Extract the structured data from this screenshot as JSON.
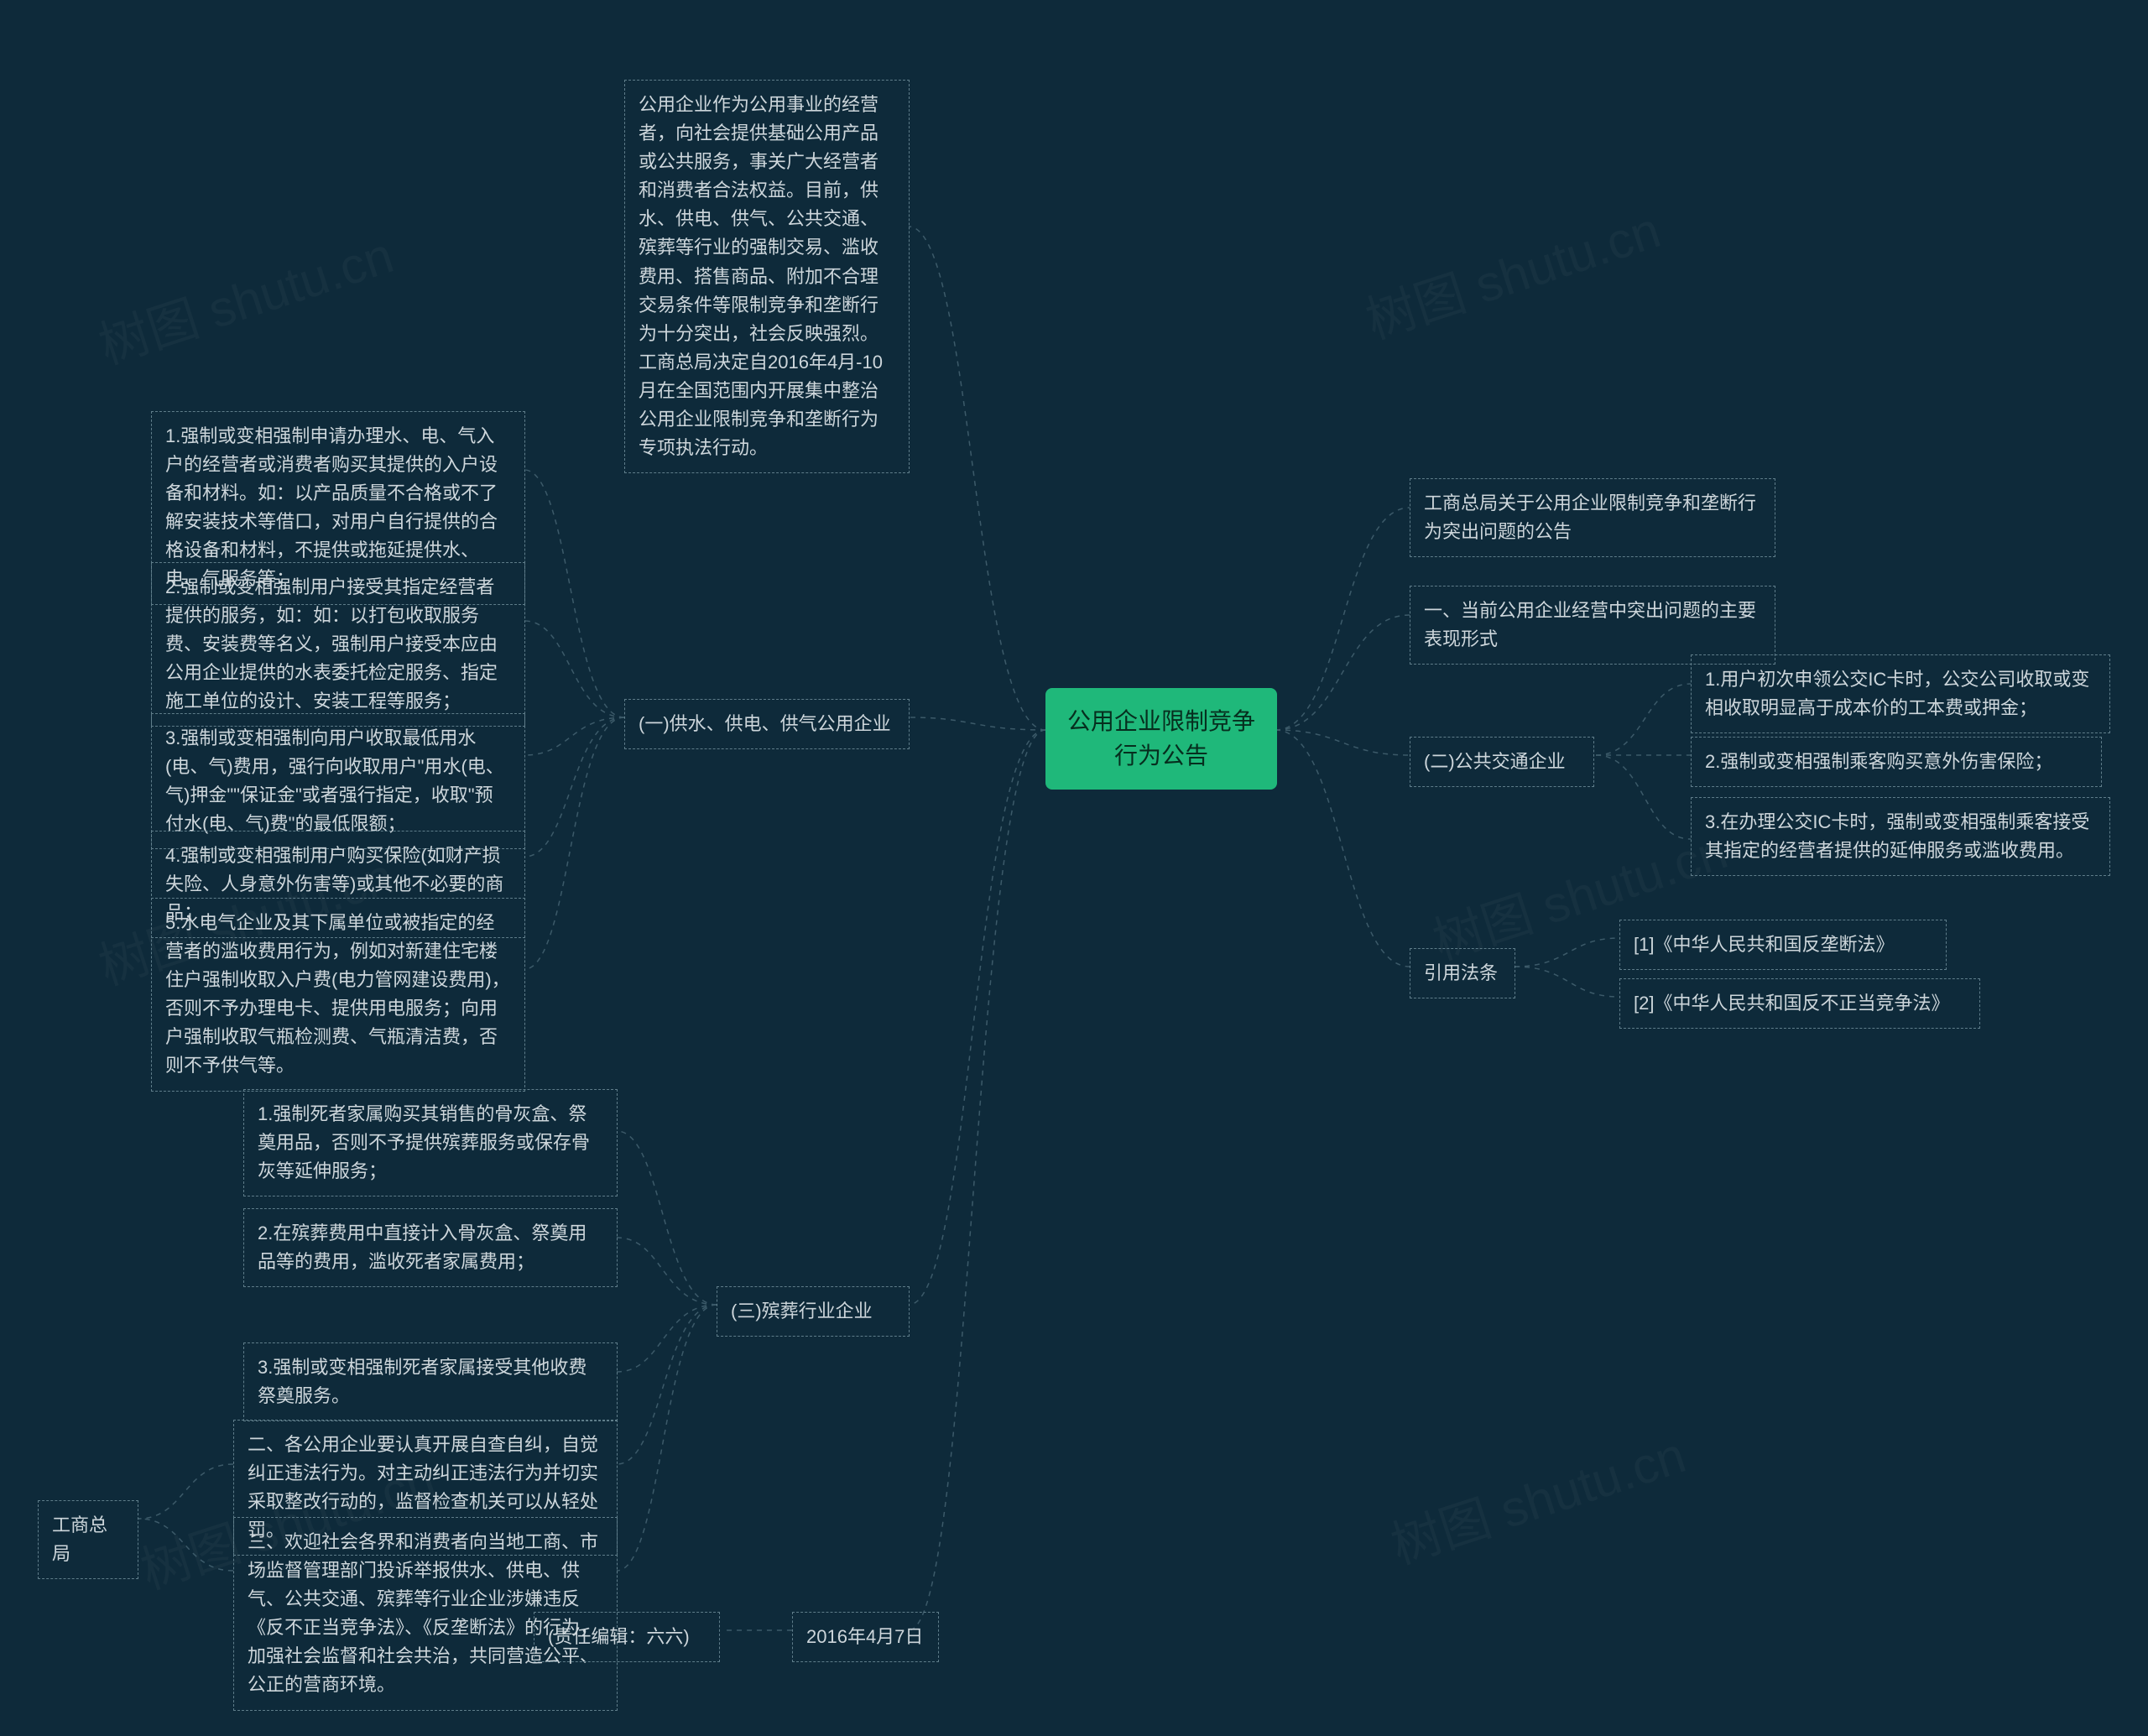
{
  "watermark": "树图 shutu.cn",
  "root": "公用企业限制竞争行为公告",
  "right": {
    "r1": "工商总局关于公用企业限制竞争和垄断行为突出问题的公告",
    "r2": "一、当前公用企业经营中突出问题的主要表现形式",
    "r3": "(二)公共交通企业",
    "r3a": "1.用户初次申领公交IC卡时，公交公司收取或变相收取明显高于成本价的工本费或押金；",
    "r3b": "2.强制或变相强制乘客购买意外伤害保险；",
    "r3c": "3.在办理公交IC卡时，强制或变相强制乘客接受其指定的经营者提供的延伸服务或滥收费用。",
    "r4": "引用法条",
    "r4a": "[1]《中华人民共和国反垄断法》",
    "r4b": "[2]《中华人民共和国反不正当竞争法》"
  },
  "left": {
    "intro": "公用企业作为公用事业的经营者，向社会提供基础公用产品或公共服务，事关广大经营者和消费者合法权益。目前，供水、供电、供气、公共交通、殡葬等行业的强制交易、滥收费用、搭售商品、附加不合理交易条件等限制竞争和垄断行为十分突出，社会反映强烈。工商总局决定自2016年4月-10月在全国范围内开展集中整治公用企业限制竞争和垄断行为专项执法行动。",
    "l1": "(一)供水、供电、供气公用企业",
    "l1a": "1.强制或变相强制申请办理水、电、气入户的经营者或消费者购买其提供的入户设备和材料。如：以产品质量不合格或不了解安装技术等借口，对用户自行提供的合格设备和材料，不提供或拖延提供水、电、气服务等；",
    "l1b": "2.强制或变相强制用户接受其指定经营者提供的服务，如：如：以打包收取服务费、安装费等名义，强制用户接受本应由公用企业提供的水表委托检定服务、指定施工单位的设计、安装工程等服务；",
    "l1c": "3.强制或变相强制向用户收取最低用水(电、气)费用，强行向收取用户\"用水(电、气)押金\"\"保证金\"或者强行指定，收取\"预付水(电、气)费\"的最低限额；",
    "l1d": "4.强制或变相强制用户购买保险(如财产损失险、人身意外伤害等)或其他不必要的商品；",
    "l1e": "5.水电气企业及其下属单位或被指定的经营者的滥收费用行为，例如对新建住宅楼住户强制收取入户费(电力管网建设费用)，否则不予办理电卡、提供用电服务；向用户强制收取气瓶检测费、气瓶清洁费，否则不予供气等。",
    "l2": "(三)殡葬行业企业",
    "l2a": "1.强制死者家属购买其销售的骨灰盒、祭奠用品，否则不予提供殡葬服务或保存骨灰等延伸服务；",
    "l2b": "2.在殡葬费用中直接计入骨灰盒、祭奠用品等的费用，滥收死者家属费用；",
    "l2c": "3.强制或变相强制死者家属接受其他收费祭奠服务。",
    "l3a": "二、各公用企业要认真开展自查自纠，自觉纠正违法行为。对主动纠正违法行为并切实采取整改行动的，监督检查机关可以从轻处罚。",
    "l3b": "三、欢迎社会各界和消费者向当地工商、市场监督管理部门投诉举报供水、供电、供气、公共交通、殡葬等行业企业涉嫌违反《反不正当竞争法》、《反垄断法》的行为，加强社会监督和社会共治，共同营造公平、公正的营商环境。",
    "l4": "工商总局",
    "l5": "2016年4月7日",
    "l5a": "(责任编辑：六六)"
  }
}
